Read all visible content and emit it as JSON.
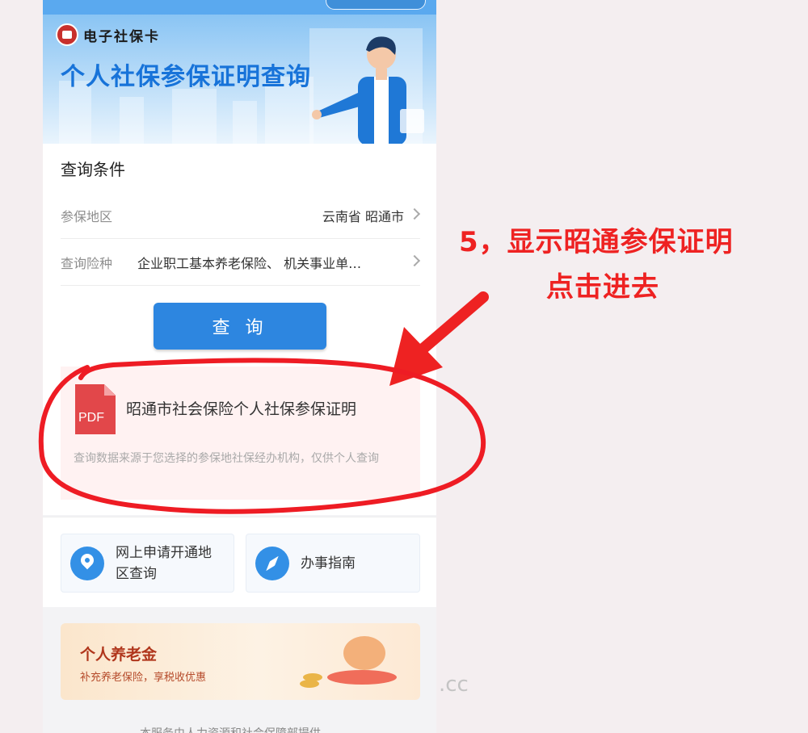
{
  "header": {
    "logo_text": "电子社保卡",
    "title": "个人社保参保证明查询"
  },
  "conditions": {
    "title": "查询条件",
    "region_label": "参保地区",
    "region_value": "云南省 昭通市",
    "type_label": "查询险种",
    "type_value": "企业职工基本养老保险、 机关事业单…",
    "query_button": "查 询"
  },
  "result": {
    "pdf_label": "PDF",
    "title": "昭通市社会保险个人社保参保证明",
    "note": "查询数据来源于您选择的参保地社保经办机构，仅供个人查询"
  },
  "links": [
    {
      "label": "网上申请开通地区查询",
      "icon": "location-pin-icon"
    },
    {
      "label": "办事指南",
      "icon": "compass-icon"
    }
  ],
  "pension": {
    "title": "个人养老金",
    "subtitle": "补充养老保险，享税收优惠"
  },
  "footer_text": "本服务由人力资源和社会保障部提供",
  "annotation": {
    "line1": "5，显示昭通参保证明",
    "line2": "点击进去"
  },
  "watermark": ".cc",
  "colors": {
    "primary_blue": "#2d86e0",
    "annotation_red": "#ee2222",
    "pdf_red": "#e2474a"
  }
}
